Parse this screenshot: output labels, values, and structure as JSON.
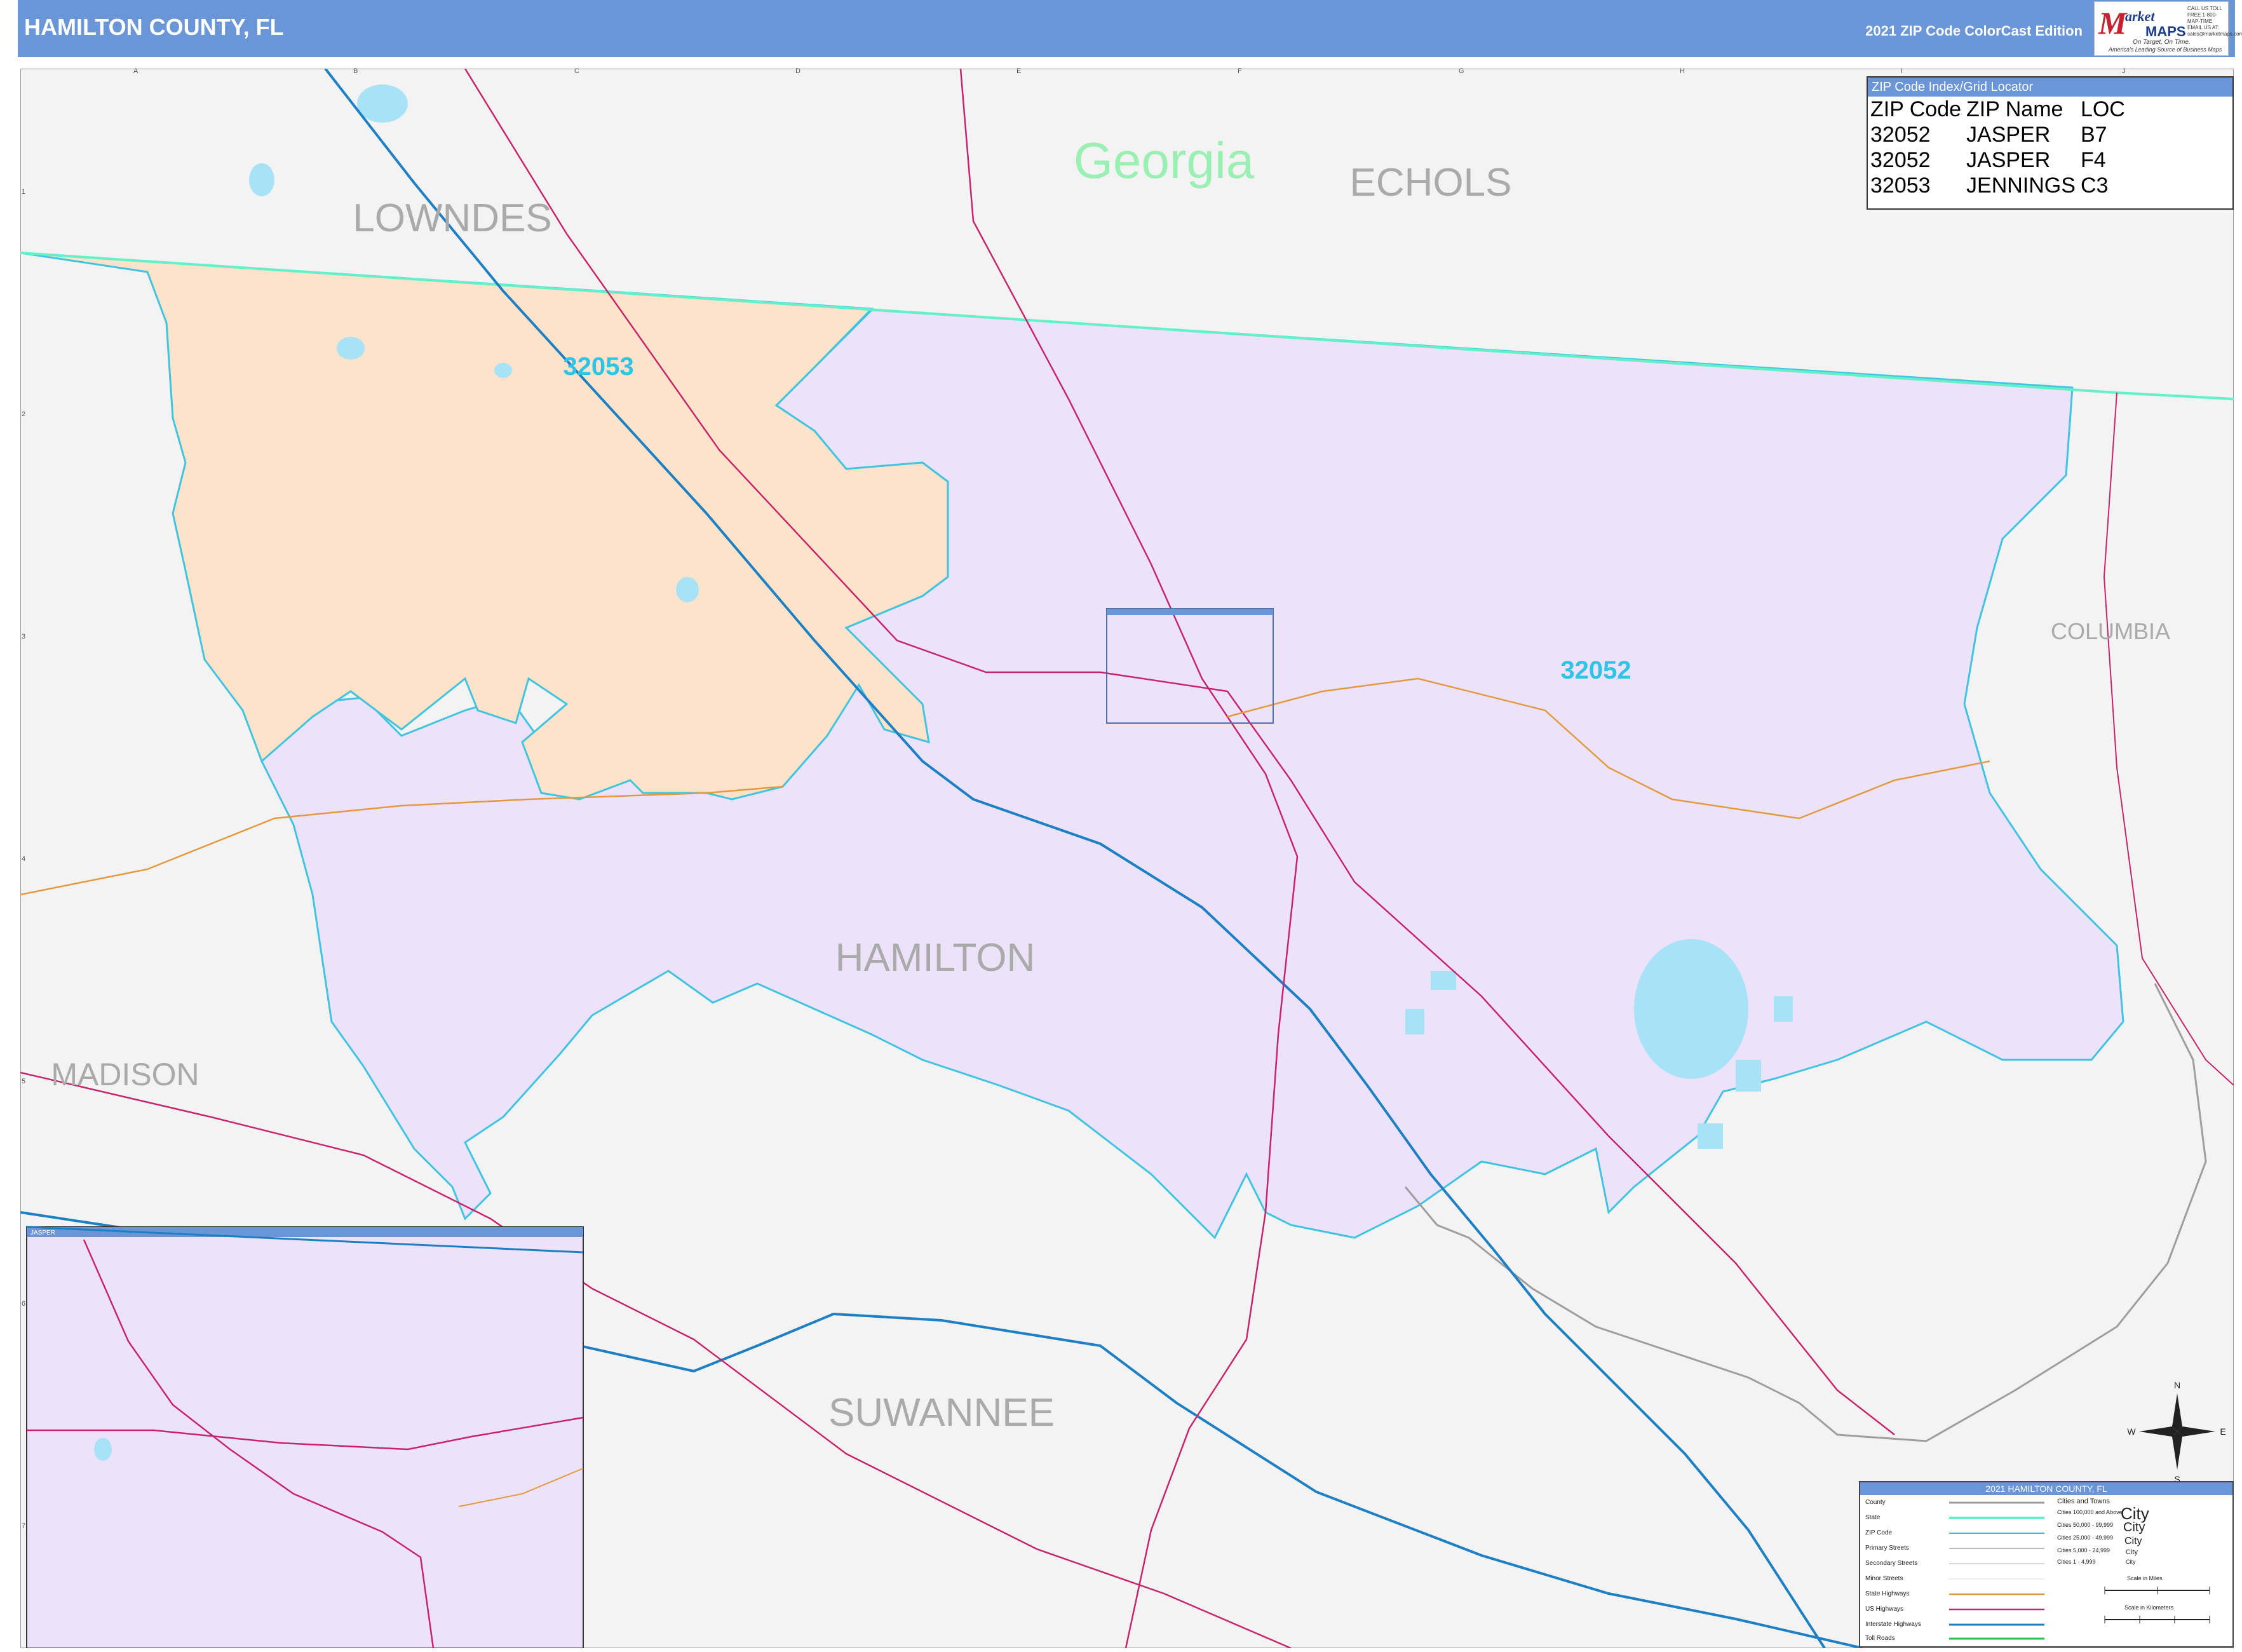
{
  "header": {
    "title": "HAMILTON COUNTY, FL",
    "edition": "2021 ZIP Code ColorCast Edition",
    "logo_m": "M",
    "logo_arket": "arket",
    "logo_maps": "MAPS",
    "logo_tagline1": "On Target, On Time.",
    "logo_tagline2": "America's Leading Source of Business Maps",
    "contact": "CALL US TOLL FREE 1-800-MAP-TIME EMAIL US AT: sales@marketmaps.com"
  },
  "map": {
    "state_label": "Georgia",
    "county_labels": [
      "LOWNDES",
      "ECHOLS",
      "COLUMBIA",
      "MADISON",
      "HAMILTON",
      "SUWANNEE"
    ],
    "zip_labels": [
      "32053",
      "32052"
    ],
    "inset_title": "JASPER",
    "colors": {
      "zip_32053": "#fde3c9",
      "zip_32052": "#ece2fa",
      "outside": "#f3f3f3",
      "water": "#a8e2f6",
      "zip_border": "#41c4e0",
      "state_line": "#64f0c8",
      "interstate": "#1d7fc4",
      "us_highway": "#c7246c",
      "state_highway": "#e39a3f"
    },
    "grid_columns": [
      "A",
      "B",
      "C",
      "D",
      "E",
      "F",
      "G",
      "H",
      "I",
      "J"
    ],
    "grid_rows": [
      "1",
      "2",
      "3",
      "4",
      "5",
      "6",
      "7"
    ]
  },
  "zip_index": {
    "title": "ZIP Code Index/Grid Locator",
    "headers": [
      "ZIP Code",
      "ZIP Name",
      "LOC"
    ],
    "rows": [
      [
        "32052",
        "JASPER",
        "B7"
      ],
      [
        "32052",
        "JASPER",
        "F4"
      ],
      [
        "32053",
        "JENNINGS",
        "C3"
      ]
    ]
  },
  "legend": {
    "title": "2021 HAMILTON COUNTY, FL",
    "items": [
      "County",
      "State",
      "ZIP Code",
      "Primary Streets",
      "Secondary Streets",
      "Minor Streets",
      "State Highways",
      "US Highways",
      "Interstate Highways",
      "Toll Roads"
    ],
    "cities_title": "Cities and Towns",
    "city_sizes": [
      "Cities 100,000 and Above",
      "Cities 50,000 - 99,999",
      "Cities 25,000 - 49,999",
      "Cities 5,000 - 24,999",
      "Cities 1 - 4,999"
    ],
    "city_samples": [
      "City",
      "City",
      "City",
      "City",
      "City"
    ],
    "scale_miles": "Scale in Miles",
    "scale_km": "Scale in Kilometers"
  },
  "compass": {
    "n": "N",
    "s": "S",
    "e": "E",
    "w": "W"
  }
}
